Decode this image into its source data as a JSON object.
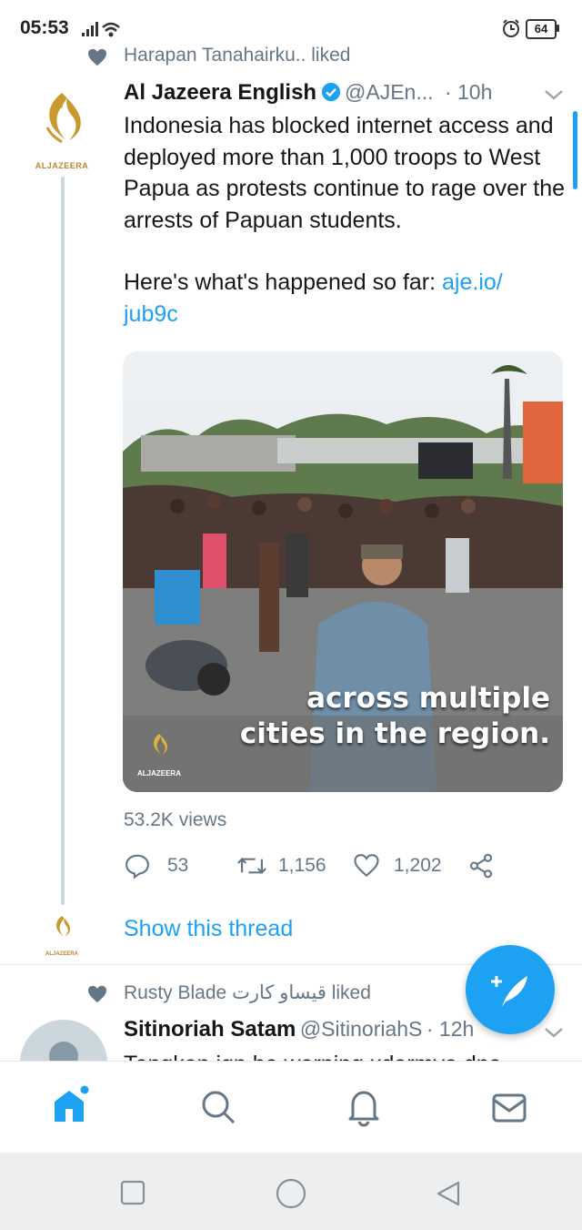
{
  "status_bar": {
    "time": "05:53",
    "battery": "64"
  },
  "tweet1": {
    "social_context": "Harapan Tanahairku.. liked",
    "display_name": "Al Jazeera English",
    "handle": "@AJEn...",
    "time": "· 10h",
    "text_p1": "Indonesia has blocked internet access and deployed more than 1,000 troops to West Papua as protests continue to rage over the arrests of Papuan students.",
    "text_p2_prefix": "Here's what's happened so far: ",
    "link_line1": "aje.io/",
    "link_line2": "jub9c",
    "avatar_label": "ALJAZEERA",
    "media": {
      "caption_line1": "across multiple",
      "caption_line2": "cities in the region.",
      "watermark": "ALJAZEERA"
    },
    "views": "53.2K views",
    "replies": "53",
    "retweets": "1,156",
    "likes": "1,202"
  },
  "thread": {
    "show_thread": "Show this thread",
    "avatar_label": "ALJAZEERA"
  },
  "tweet2": {
    "social_context": "Rusty Blade قيساو كارت liked",
    "display_name": "Sitinoriah Satam",
    "handle": "@SitinoriahS",
    "time": "· 12h",
    "text_partial": "Tengkan ign ha warning xdarmya dna"
  },
  "colors": {
    "accent": "#1da1f2",
    "text": "#14171a",
    "secondary": "#657786"
  },
  "icons": [
    "heart-icon",
    "verified-icon",
    "chevron-down-icon",
    "reply-icon",
    "retweet-icon",
    "like-icon",
    "share-icon",
    "compose-icon",
    "home-icon",
    "search-icon",
    "notifications-icon",
    "messages-icon"
  ]
}
